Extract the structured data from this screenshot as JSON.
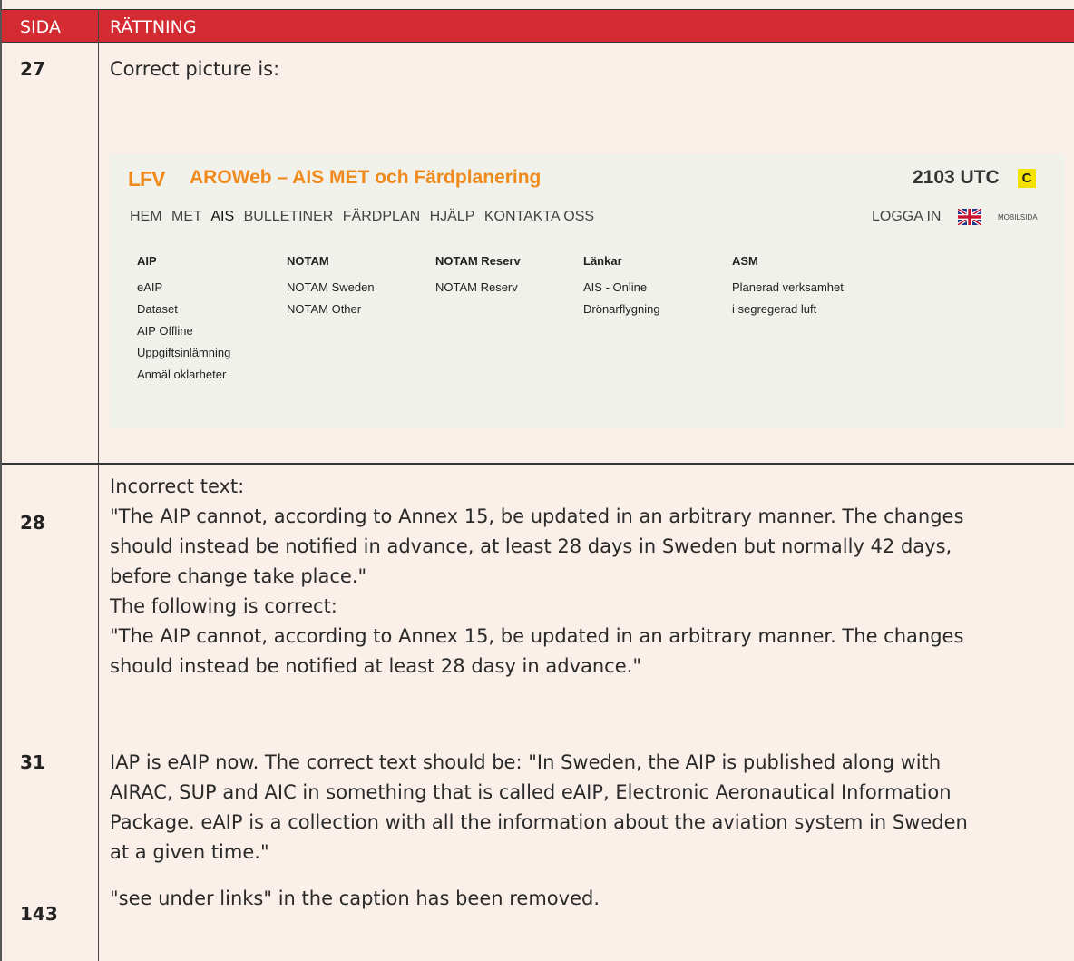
{
  "header": {
    "col1": "SIDA",
    "col2": "RÄTTNING"
  },
  "rows": [
    {
      "page": "27",
      "text": "Correct picture is:"
    },
    {
      "page": "28",
      "lines": [
        "Incorrect text:",
        "\"The AIP cannot, according to Annex 15, be updated in an arbitrary manner. The changes",
        "should instead be notified in advance, at least 28 days in Sweden but normally 42 days,",
        "before change take place.\"",
        "The following is correct:",
        "\"The AIP cannot, according to Annex 15, be updated in an arbitrary manner. The changes",
        "should instead be notified at least 28 dasy in advance.\""
      ]
    },
    {
      "page": "31",
      "lines": [
        "IAP is eAIP now. The correct text should be: \"In Sweden, the AIP is published along with",
        "AIRAC, SUP and AIC in something that is called eAIP, Electronic Aeronautical Information",
        "Package. eAIP is a collection with all the information about the aviation system in Sweden",
        "at a given time.\""
      ]
    },
    {
      "page": "143",
      "text": "\"see under links\" in the caption has been removed."
    }
  ],
  "screenshot": {
    "logo": "LFV",
    "title": "AROWeb – AIS MET och Färdplanering",
    "utc": "2103 UTC",
    "badge": "C",
    "nav": [
      "HEM",
      "MET",
      "AIS",
      "BULLETINER",
      "FÄRDPLAN",
      "HJÄLP",
      "KONTAKTA OSS"
    ],
    "login": "LOGGA IN",
    "mobile": "MOBILSIDA",
    "columns": [
      {
        "heading": "AIP",
        "items": [
          "eAIP",
          "Dataset",
          "AIP Offline",
          "Uppgiftsinlämning",
          "Anmäl oklarheter"
        ]
      },
      {
        "heading": "NOTAM",
        "items": [
          "NOTAM Sweden",
          "NOTAM Other"
        ]
      },
      {
        "heading": "NOTAM Reserv",
        "items": [
          "NOTAM Reserv"
        ]
      },
      {
        "heading": "Länkar",
        "items": [
          "AIS - Online",
          "Drönarflygning"
        ]
      },
      {
        "heading": "ASM",
        "items": [
          "Planerad verksamhet",
          "i segregerad luft"
        ]
      }
    ]
  },
  "colors": {
    "header_red": "#d42a31",
    "page_bg": "#fbefea",
    "logo_orange": "#ef8a1c",
    "badge_yellow": "#f5e200"
  }
}
